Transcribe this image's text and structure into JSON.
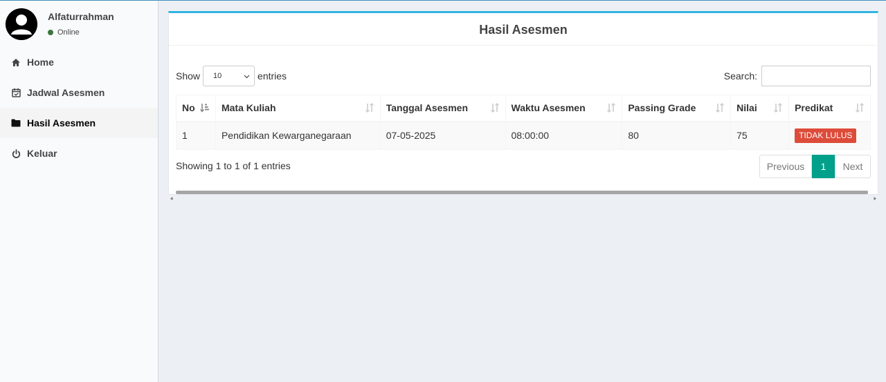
{
  "user": {
    "name": "Alfaturrahman",
    "status": "Online"
  },
  "menu": [
    {
      "label": "Home",
      "icon": "home-icon"
    },
    {
      "label": "Jadwal Asesmen",
      "icon": "calendar-check-icon"
    },
    {
      "label": "Hasil Asesmen",
      "icon": "folder-icon",
      "active": true
    },
    {
      "label": "Keluar",
      "icon": "power-icon"
    }
  ],
  "box": {
    "title": "Hasil Asesmen"
  },
  "table_controls": {
    "show_label": "Show",
    "entries_label": "entries",
    "page_length": "10",
    "search_label": "Search:",
    "search_value": ""
  },
  "table": {
    "columns": [
      "No",
      "Mata Kuliah",
      "Tanggal Asesmen",
      "Waktu Asesmen",
      "Passing Grade",
      "Nilai",
      "Predikat"
    ],
    "rows": [
      {
        "no": "1",
        "mata_kuliah": "Pendidikan Kewarganegaraan",
        "tanggal": "07-05-2025",
        "waktu": "08:00:00",
        "passing_grade": "80",
        "nilai": "75",
        "predikat": "TIDAK LULUS"
      }
    ]
  },
  "pagination": {
    "info": "Showing 1 to 1 of 1 entries",
    "previous": "Previous",
    "current": "1",
    "next": "Next"
  },
  "colors": {
    "accent": "#30b4e1",
    "active_page": "#00a08a",
    "badge_danger": "#dd4b39",
    "status_online": "#3c763d"
  }
}
